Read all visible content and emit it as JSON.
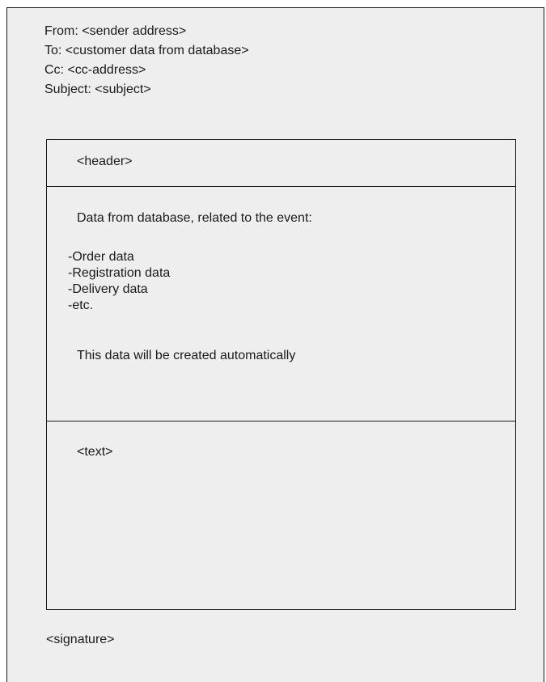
{
  "email_headers": {
    "from": "From: <sender address>",
    "to": "To: <customer data from database>",
    "cc": "Cc: <cc-address>",
    "subject": "Subject: <subject>"
  },
  "body": {
    "header_placeholder": "<header>",
    "data_section": {
      "intro": "Data from database, related to the event:",
      "items": [
        "-Order data",
        "-Registration data",
        "-Delivery data",
        "-etc."
      ],
      "note": "This data will be created automatically"
    },
    "text_placeholder": "<text>"
  },
  "signature": "<signature>"
}
